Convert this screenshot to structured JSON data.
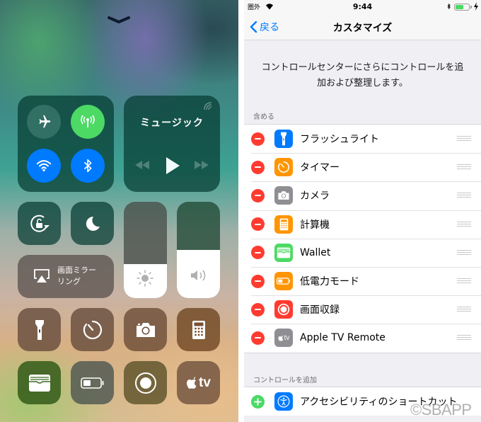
{
  "control_center": {
    "dismiss_icon": "chevron-down-icon",
    "connectivity": {
      "airplane": {
        "icon": "airplane-icon",
        "active": false
      },
      "cellular": {
        "icon": "antenna-icon",
        "active": true,
        "color": "#4cd964"
      },
      "wifi": {
        "icon": "wifi-icon",
        "active": true,
        "color": "#007aff"
      },
      "bluetooth": {
        "icon": "bluetooth-icon",
        "active": true,
        "color": "#007aff"
      }
    },
    "music": {
      "title": "ミュージック",
      "icons": [
        "airplay-audio-icon",
        "rewind-icon",
        "play-icon",
        "fast-forward-icon"
      ]
    },
    "orientation_lock": {
      "icon": "rotation-lock-icon"
    },
    "do_not_disturb": {
      "icon": "moon-icon"
    },
    "screen_mirroring": {
      "label_line1": "画面ミラー",
      "label_line2": "リング",
      "icon": "airplay-screen-icon"
    },
    "brightness": {
      "icon": "sun-icon",
      "level_percent": 35
    },
    "volume": {
      "icon": "speaker-icon",
      "level_percent": 50
    },
    "shortcuts": [
      {
        "name": "flashlight",
        "icon": "flashlight-icon"
      },
      {
        "name": "timer",
        "icon": "timer-icon"
      },
      {
        "name": "camera",
        "icon": "camera-icon"
      },
      {
        "name": "calculator",
        "icon": "calculator-icon"
      },
      {
        "name": "wallet",
        "icon": "wallet-icon"
      },
      {
        "name": "low-power",
        "icon": "battery-icon"
      },
      {
        "name": "screen-recording",
        "icon": "record-icon"
      },
      {
        "name": "apple-tv-remote",
        "icon": "apple-tv-icon",
        "text": "tv"
      }
    ]
  },
  "settings": {
    "status_bar": {
      "carrier": "圏外",
      "time": "9:44",
      "battery_percent": 60,
      "charging": true,
      "bluetooth": true
    },
    "nav": {
      "back_label": "戻る",
      "title": "カスタマイズ"
    },
    "description": "コントロールセンターにさらにコントロールを追加および整理します。",
    "included_header": "含める",
    "included": [
      {
        "label": "フラッシュライト",
        "icon": "flashlight-icon",
        "color": "#007aff"
      },
      {
        "label": "タイマー",
        "icon": "timer-icon",
        "color": "#ff9500"
      },
      {
        "label": "カメラ",
        "icon": "camera-icon",
        "color": "#8e8e93"
      },
      {
        "label": "計算機",
        "icon": "calculator-icon",
        "color": "#ff9500"
      },
      {
        "label": "Wallet",
        "icon": "wallet-icon",
        "color": "#4cd964"
      },
      {
        "label": "低電力モード",
        "icon": "battery-icon",
        "color": "#ff9500"
      },
      {
        "label": "画面収録",
        "icon": "record-icon",
        "color": "#ff3b30"
      },
      {
        "label": "Apple TV Remote",
        "icon": "apple-tv-icon",
        "color": "#8e8e93",
        "icon_text": "tv"
      }
    ],
    "more_header": "コントロールを追加",
    "more": [
      {
        "label": "アクセシビリティのショートカット",
        "icon": "accessibility-icon",
        "color": "#007aff"
      }
    ]
  },
  "watermark": "©SBAPP"
}
